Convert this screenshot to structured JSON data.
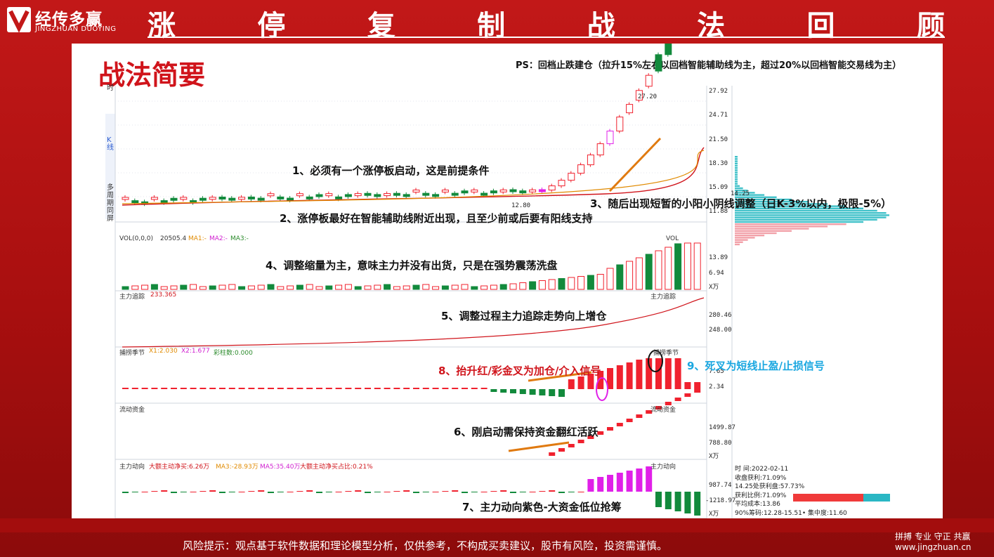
{
  "header": {
    "logo_cn": "经传多赢",
    "logo_en": "JINGZHUAN DUOYING",
    "title_chars": [
      "涨",
      "停",
      "复",
      "制",
      "战",
      "法",
      "回",
      "顾"
    ]
  },
  "panel": {
    "heading": "战法简要",
    "ps_note": "PS：回档止跌建仓（拉升15%左右以回档智能辅助线为主，超过20%以回档智能交易线为主）"
  },
  "left_ruler": {
    "time_label": "时",
    "k_label": "K\n线",
    "multi_label": "多\n周\n期\n同\n屏"
  },
  "price_axis": [
    "27.92",
    "24.71",
    "21.50",
    "18.30",
    "15.09",
    "11.88"
  ],
  "price_marks": {
    "high": "27.20",
    "low": "12.80",
    "cost": "14.25"
  },
  "volume_pane": {
    "title": "VOL(0,0,0)",
    "value": "20505.4",
    "ma1": "MA1:-",
    "ma2": "MA2:-",
    "ma3": "MA3:-",
    "right_tag": "VOL",
    "axis": [
      "13.89",
      "6.94",
      "X万"
    ]
  },
  "trace_pane": {
    "title": "主力追踪",
    "value": "233.365",
    "right_tag": "主力追踪",
    "axis": [
      "280.46",
      "248.00"
    ]
  },
  "season_pane": {
    "title": "捕捞季节",
    "x1": "X1:2.030",
    "x2": "X2:1.677",
    "bars": "彩柱数:0.000",
    "right_tag": "捕捞季节",
    "axis": [
      "7.65",
      "2.34"
    ]
  },
  "liquid_pane": {
    "title": "流动资金",
    "right_tag": "流动资金",
    "axis": [
      "1499.87",
      "788.80",
      "X万"
    ]
  },
  "direction_pane": {
    "title": "主力动向",
    "big_net": "大额主动净买:6.26万",
    "ma3": "MA3:-28.93万",
    "ma5": "MA5:35.40万",
    "ratio": "大额主动净买占比:0.21%",
    "right_tag": "主力动向",
    "axis": [
      "987.74",
      "-1218.97",
      "X万"
    ]
  },
  "annotations": {
    "a1": "1、必须有一个涨停板启动，这是前提条件",
    "a2": "2、涨停板最好在智能辅助线附近出现，且至少前或后要有阳线支持",
    "a3": "3、随后出现短暂的小阳小阴线调整（日K-3%以内，极限-5%）",
    "a4": "4、调整缩量为主，意味主力并没有出货，只是在强势震荡洗盘",
    "a5": "5、调整过程主力追踪走势向上增仓",
    "a6": "6、刚启动需保持资金翻红活跃",
    "a7": "7、主力动向紫色-大资金低位抢筹",
    "a8": "8、抬升红/彩金叉为加仓/介入信号",
    "a9": "9、死叉为短线止盈/止损信号"
  },
  "info_box": {
    "time": "时          间:2022-02-11",
    "profit": "收盘获利:71.09%",
    "cost_profit": "14.25处获利盘:57.73%",
    "profit_ratio": "获利比例:71.09%",
    "avg_cost": "平均成本:13.86",
    "chips": "90%筹码:12.28-15.51• 集中度:11.60"
  },
  "colors": {
    "up": "#f0212e",
    "down": "#128a3c",
    "purple": "#e020e8",
    "accent": "#d0141b",
    "cyan": "#2ab7c4"
  },
  "footer": {
    "risk": "风险提示：观点基于软件数据和理论模型分析，仅供参考，不构成买卖建议，股市有风险，投资需谨慎。",
    "slogan": "拼搏 专业 守正 共赢",
    "site": "www.jingzhuan.cn"
  }
}
